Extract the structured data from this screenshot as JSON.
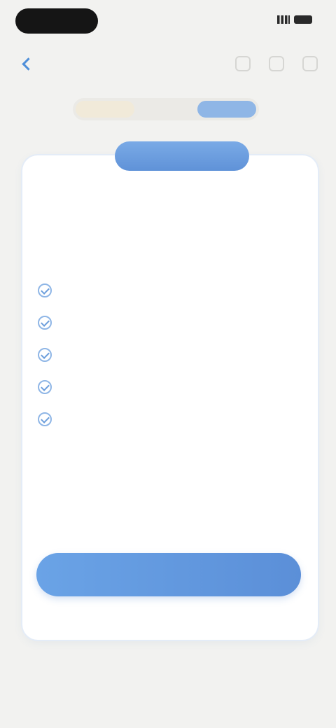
{
  "navigation": {
    "back_label": ""
  },
  "tabs": [
    {
      "label": ""
    },
    {
      "label": ""
    },
    {
      "label": "",
      "selected": true
    }
  ],
  "plan_card": {
    "badge": "",
    "title": "",
    "subtitle": "",
    "features_heading": "",
    "features": [
      {
        "text": ""
      },
      {
        "text": ""
      },
      {
        "text": ""
      },
      {
        "text": ""
      },
      {
        "text": ""
      }
    ],
    "note": "",
    "price": "",
    "price_period": "",
    "price_note": "",
    "cta_label": ""
  },
  "section": {
    "title": "",
    "subtitle": ""
  },
  "colors": {
    "accent": "#5b8fd8",
    "accent_light": "#8fb6e6",
    "tab_inactive_highlight": "#f1ead9",
    "background": "#f2f2f0"
  },
  "icons": {
    "back": "chevron-left-icon",
    "feature": "check-circle-icon"
  }
}
